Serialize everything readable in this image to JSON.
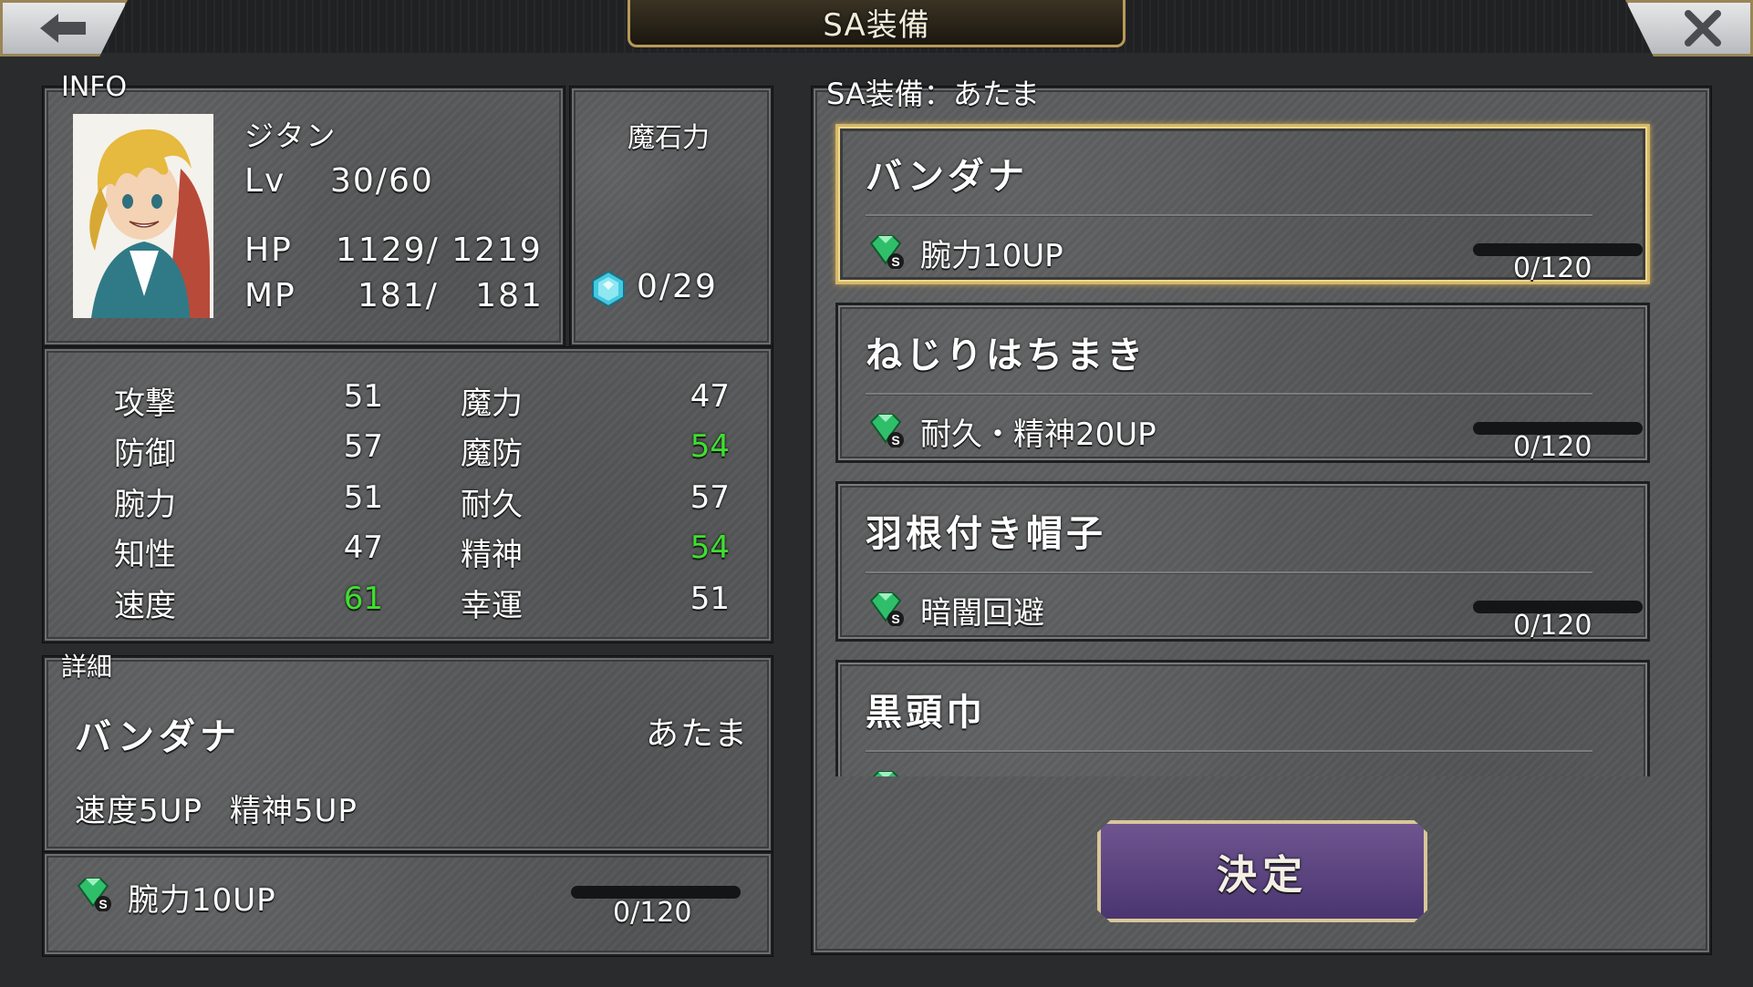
{
  "header": {
    "title": "SA装備"
  },
  "info": {
    "label": "INFO",
    "name": "ジタン",
    "lv_label": "Lv",
    "lv_value": "30/60",
    "hp_label": "HP",
    "hp_value": "1129/ 1219",
    "mp_label": "MP",
    "mp_value": "181/   181"
  },
  "magicite": {
    "label": "魔石力",
    "value": "0/29"
  },
  "stats": [
    {
      "label": "攻撃",
      "value": "51",
      "highlight": false
    },
    {
      "label": "防御",
      "value": "57",
      "highlight": false
    },
    {
      "label": "腕力",
      "value": "51",
      "highlight": false
    },
    {
      "label": "知性",
      "value": "47",
      "highlight": false
    },
    {
      "label": "速度",
      "value": "61",
      "highlight": true
    },
    {
      "label": "魔力",
      "value": "47",
      "highlight": false
    },
    {
      "label": "魔防",
      "value": "54",
      "highlight": true
    },
    {
      "label": "耐久",
      "value": "57",
      "highlight": false
    },
    {
      "label": "精神",
      "value": "54",
      "highlight": true
    },
    {
      "label": "幸運",
      "value": "51",
      "highlight": false
    }
  ],
  "detail": {
    "label": "詳細",
    "item_name": "バンダナ",
    "slot": "あたま",
    "effects": "速度5UP 精神5UP",
    "sa_effect": "腕力10UP",
    "progress_text": "0/120",
    "progress": 0
  },
  "sa_list": {
    "label": "SA装備：あたま",
    "items": [
      {
        "name": "バンダナ",
        "effect": "腕力10UP",
        "progress_text": "0/120",
        "selected": true
      },
      {
        "name": "ねじりはちまき",
        "effect": "耐久・精神20UP",
        "progress_text": "0/120",
        "selected": false
      },
      {
        "name": "羽根付き帽子",
        "effect": "暗闇回避",
        "progress_text": "0/120",
        "selected": false
      },
      {
        "name": "黒頭巾",
        "effect": "",
        "progress_text": "",
        "selected": false
      }
    ]
  },
  "confirm_label": "決定",
  "colors": {
    "highlight": "#3ee02f",
    "accent_gold": "#d4b86a",
    "button_purple": "#5a4280"
  }
}
